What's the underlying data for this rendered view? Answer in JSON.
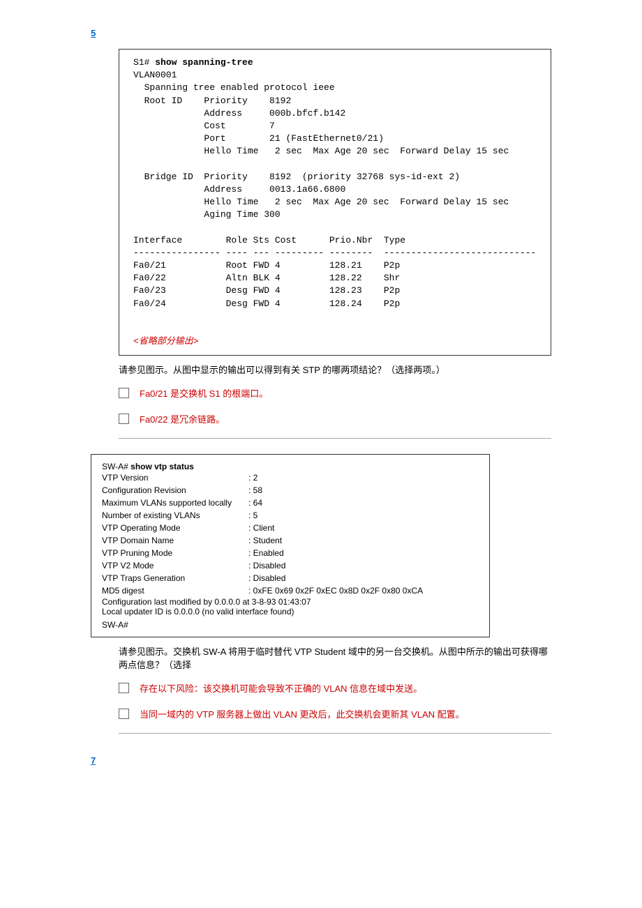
{
  "section5": {
    "num": "5",
    "codeBox": {
      "prompt": "S1#",
      "command": "show spanning-tree",
      "vlan": "VLAN0001",
      "stpLine": "  Spanning tree enabled protocol ieee",
      "rootId": {
        "priority": "8192",
        "address": "000b.bfcf.b142",
        "cost": "7",
        "port": "21 (FastEthernet0/21)",
        "hello": "Hello Time   2 sec  Max Age 20 sec  Forward Delay 15 sec"
      },
      "bridgeId": {
        "priority": "8192  (priority 32768 sys-id-ext 2)",
        "address": "0013.1a66.6800",
        "hello": "Hello Time   2 sec  Max Age 20 sec  Forward Delay 15 sec",
        "aging": "Aging Time 300"
      },
      "tableHeader": "Interface        Role Sts Cost      Prio.Nbr  Type",
      "divider": "---------------- ---- --- --------- --------  ----------------------------",
      "rows": [
        "Fa0/21           Root FWD 4         128.21    P2p",
        "Fa0/22           Altn BLK 4         128.22    Shr",
        "Fa0/23           Desg FWD 4         128.23    P2p",
        "Fa0/24           Desg FWD 4         128.24    P2p"
      ],
      "omitted": "<省略部分输出>"
    },
    "question": "请参见图示。从图中显示的输出可以得到有关 STP 的哪两项结论？（选择两项。）",
    "options": [
      "Fa0/21 是交换机 S1 的根端口。",
      "Fa0/22 是冗余链路。"
    ]
  },
  "section6": {
    "vtpBox": {
      "prompt": "SW-A#",
      "command": "show vtp status",
      "rows": [
        {
          "label": "VTP Version",
          "value": ": 2"
        },
        {
          "label": "Configuration Revision",
          "value": ": 58"
        },
        {
          "label": "Maximum VLANs supported locally",
          "value": ": 64"
        },
        {
          "label": "Number of existing VLANs",
          "value": ": 5"
        },
        {
          "label": "VTP Operating Mode",
          "value": ": Client"
        },
        {
          "label": "VTP Domain Name",
          "value": ": Student"
        },
        {
          "label": "VTP Pruning Mode",
          "value": ": Enabled"
        },
        {
          "label": "VTP V2 Mode",
          "value": ": Disabled"
        },
        {
          "label": "VTP Traps Generation",
          "value": ": Disabled"
        },
        {
          "label": "MD5 digest",
          "value": ": 0xFE 0x69 0x2F 0xEC 0x8D 0x2F 0x80 0xCA"
        }
      ],
      "line1": "Configuration last modified by 0.0.0.0 at 3-8-93 01:43:07",
      "line2": "Local updater ID is 0.0.0.0 (no valid interface found)",
      "endPrompt": "SW-A#"
    },
    "question": "请参见图示。交换机 SW-A 将用于临时替代 VTP Student 域中的另一台交换机。从图中所示的输出可获得哪两点信息？（选择",
    "options": [
      "存在以下风险：该交换机可能会导致不正确的 VLAN 信息在域中发送。",
      "当同一域内的 VTP 服务器上做出 VLAN 更改后，此交换机会更新其 VLAN 配置。"
    ]
  },
  "section7": {
    "num": "7"
  }
}
